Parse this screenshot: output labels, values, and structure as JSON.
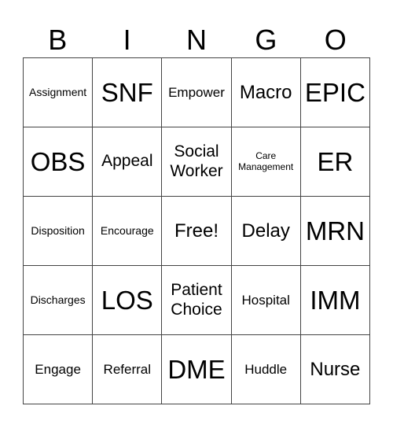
{
  "header": {
    "letters": [
      "B",
      "I",
      "N",
      "G",
      "O"
    ]
  },
  "cells": [
    [
      {
        "text": "Assignment",
        "size": "sm"
      },
      {
        "text": "SNF",
        "size": "xxl"
      },
      {
        "text": "Empower",
        "size": "md"
      },
      {
        "text": "Macro",
        "size": "xl"
      },
      {
        "text": "EPIC",
        "size": "xxl"
      }
    ],
    [
      {
        "text": "OBS",
        "size": "xxl"
      },
      {
        "text": "Appeal",
        "size": "lg"
      },
      {
        "text": "Social Worker",
        "size": "lg"
      },
      {
        "text": "Care Management",
        "size": "xs"
      },
      {
        "text": "ER",
        "size": "xxl"
      }
    ],
    [
      {
        "text": "Disposition",
        "size": "sm"
      },
      {
        "text": "Encourage",
        "size": "sm"
      },
      {
        "text": "Free!",
        "size": "xl"
      },
      {
        "text": "Delay",
        "size": "xl"
      },
      {
        "text": "MRN",
        "size": "xxl"
      }
    ],
    [
      {
        "text": "Discharges",
        "size": "sm"
      },
      {
        "text": "LOS",
        "size": "xxl"
      },
      {
        "text": "Patient Choice",
        "size": "lg"
      },
      {
        "text": "Hospital",
        "size": "md"
      },
      {
        "text": "IMM",
        "size": "xxl"
      }
    ],
    [
      {
        "text": "Engage",
        "size": "md"
      },
      {
        "text": "Referral",
        "size": "md"
      },
      {
        "text": "DME",
        "size": "xxl"
      },
      {
        "text": "Huddle",
        "size": "md"
      },
      {
        "text": "Nurse",
        "size": "xl"
      }
    ]
  ]
}
